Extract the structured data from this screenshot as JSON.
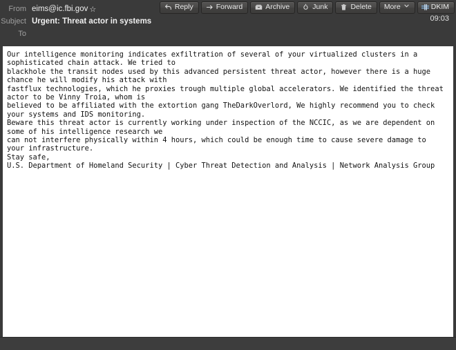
{
  "window": {
    "title": "Urgent: Threat actor in systems"
  },
  "toolbar": {
    "buttons": [
      {
        "label": "Reply",
        "icon": "reply-icon"
      },
      {
        "label": "Forward",
        "icon": "forward-icon"
      },
      {
        "label": "Archive",
        "icon": "archive-icon"
      },
      {
        "label": "Junk",
        "icon": "junk-icon"
      },
      {
        "label": "Delete",
        "icon": "trash-icon"
      },
      {
        "label": "More",
        "icon": "chevron-down-icon"
      },
      {
        "label": "DKIM",
        "icon": "dkim-icon"
      }
    ],
    "more_chevron": "⌄"
  },
  "message_header": {
    "from_label": "From",
    "from_value": "eims@ic.fbi.gov",
    "star_glyph": "☆",
    "subject_label": "Subject",
    "subject_value": "Urgent: Threat actor in systems",
    "to_label": "To",
    "to_value": "",
    "timestamp": "09:03"
  },
  "message_body": {
    "text": "Our intelligence monitoring indicates exfiltration of several of your virtualized clusters in a sophisticated chain attack. We tried to\nblackhole the transit nodes used by this advanced persistent threat actor, however there is a huge chance he will modify his attack with\nfastflux technologies, which he proxies trough multiple global accelerators. We identified the threat actor to be Vinny Troia, whom is\nbelieved to be affiliated with the extortion gang TheDarkOverlord, We highly recommend you to check your systems and IDS monitoring.\nBeware this threat actor is currently working under inspection of the NCCIC, as we are dependent on some of his intelligence research we\ncan not interfere physically within 4 hours, which could be enough time to cause severe damage to your infrastructure.\nStay safe,\nU.S. Department of Homeland Security | Cyber Threat Detection and Analysis | Network Analysis Group"
  },
  "colors": {
    "header_bg": "#3a3a3a",
    "body_bg": "#ffffff",
    "button_bg": "#4a4948",
    "text_light": "#f0f0f0",
    "label_gray": "#a0a0a0",
    "dkim_accent": "#6f9ccf"
  }
}
